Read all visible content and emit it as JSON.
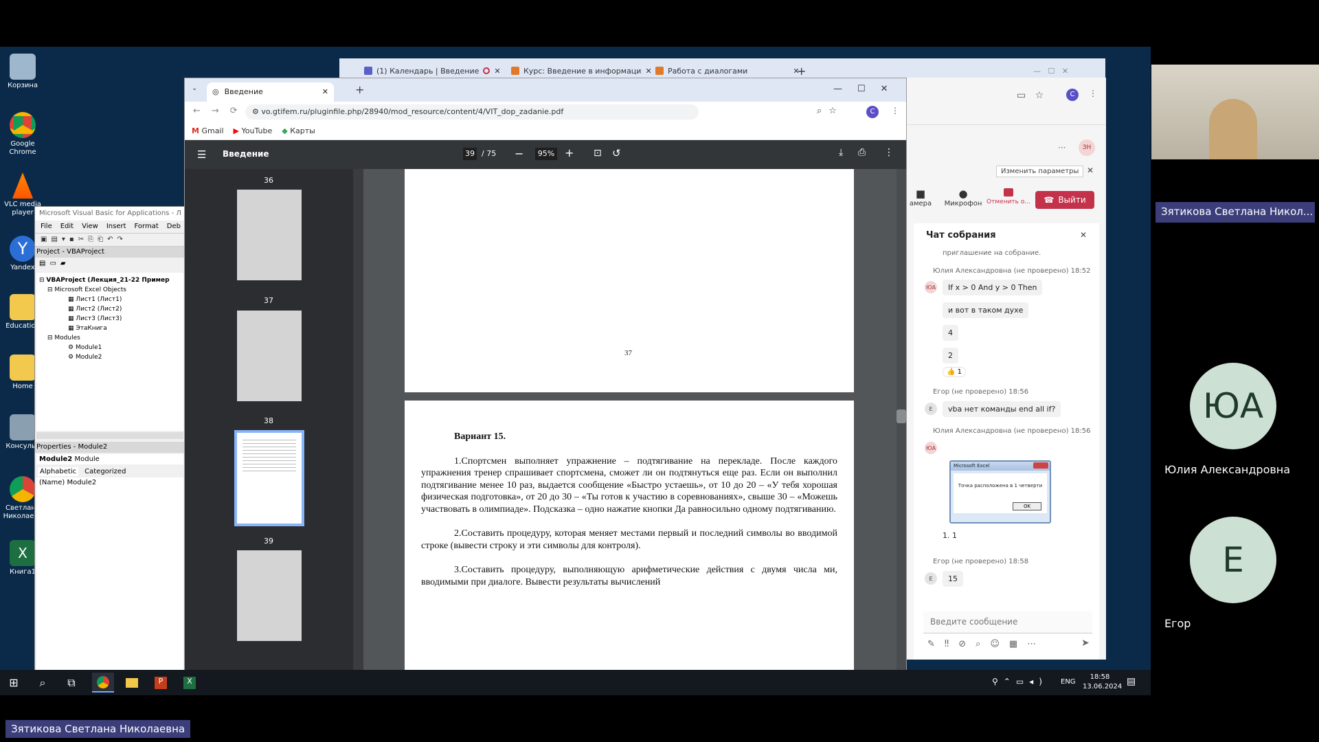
{
  "desktop": {
    "icons": [
      "Корзина",
      "Google Chrome",
      "VLC media player",
      "Yandex",
      "Education",
      "Home",
      "Консульт",
      "Светлана Николаева",
      "Книга1"
    ]
  },
  "taskbar": {
    "lang": "ENG",
    "time": "18:58",
    "date": "13.06.2024"
  },
  "back_browser": {
    "tabs": [
      "(1) Календарь | Введение",
      "Курс: Введение в информаци",
      "Работа с диалогами"
    ]
  },
  "vba": {
    "title": "Microsoft Visual Basic for Applications - Л",
    "menu": [
      "File",
      "Edit",
      "View",
      "Insert",
      "Format",
      "Deb"
    ],
    "project_title": "Project - VBAProject",
    "tree": [
      "VBAProject (Лекция_21-22 Пример",
      "Microsoft Excel Objects",
      "Лист1 (Лист1)",
      "Лист2 (Лист2)",
      "Лист3 (Лист3)",
      "ЭтаКнига",
      "Modules",
      "Module1",
      "Module2"
    ],
    "properties_title": "Properties - Module2",
    "prop_object": "Module2",
    "prop_type": "Module",
    "prop_tabs": [
      "Alphabetic",
      "Categorized"
    ],
    "prop_name_key": "(Name)",
    "prop_name_val": "Module2"
  },
  "browser": {
    "tab_title": "Введение",
    "url": "vo.gtifem.ru/pluginfile.php/28940/mod_resource/content/4/VIT_dop_zadanie.pdf",
    "profile": "С",
    "bookmarks": [
      "Gmail",
      "YouTube",
      "Карты"
    ]
  },
  "pdf": {
    "doc_title": "Введение",
    "page_current": "39",
    "page_total": "/ 75",
    "zoom": "95%",
    "thumb_labels": [
      "36",
      "37",
      "38",
      "39"
    ],
    "page37_number": "37",
    "heading": "Вариант 15.",
    "p1": "1.Спортсмен выполняет упражнение – подтягивание на перекладе. После каждого упражнения тренер спрашивает спортсмена, сможет ли он подтянуться еще раз. Если он выполнил подтягивание менее 10 раз, выдается сообщение «Быстро устаешь», от 10 до 20 – «У тебя хорошая физическая подготовка», от 20 до 30 – «Ты готов к участию в соревнованиях», свыше 30 – «Можешь участвовать в олимпиаде». Подсказка – одно нажатие кнопки Да равносильно одному подтягиванию.",
    "p2": "2.Составить процедуру, которая меняет местами первый и последний символы во вводимой строке (вывести строку и эти символы для контроля).",
    "p3": "3.Составить процедуру, выполняющую арифметические действия с двумя числа ми, вводимыми при диалоге. Вывести результаты вычислений"
  },
  "teams": {
    "avatar": "ЗН",
    "change_params": "Изменить параметры",
    "camera": "амера",
    "mic": "Микрофон",
    "cancel": "Отменить о...",
    "leave": "Выйти",
    "chat_title": "Чат собрания",
    "cut_text": "приглашение на собрание.",
    "messages": [
      {
        "meta": "Юлия Александровна (не проверено)  18:52",
        "initials": "ЮА",
        "lines": [
          "If x > 0 And y > 0 Then",
          "и вот в таком духе",
          "4",
          "2"
        ],
        "reaction": "👍 1"
      },
      {
        "meta": "Егор (не проверено)  18:56",
        "initials": "Е",
        "lines": [
          "vba нет команды end all if?"
        ]
      },
      {
        "meta": "Юлия Александровна (не проверено)  18:56",
        "initials": "ЮА",
        "dialog_title": "Microsoft Excel",
        "dialog_text": "Точка расположена в 1 четверти",
        "dialog_ok": "OK",
        "after": "1. 1"
      },
      {
        "meta": "Егор (не проверено)  18:58",
        "initials": "Е",
        "lines": [
          "15"
        ]
      }
    ],
    "input_placeholder": "Введите сообщение"
  },
  "participants": {
    "speaker_name": "Зятикова Светлана Никол...",
    "p1_initials": "ЮА",
    "p1_name": "Юлия Александровна",
    "p2_initials": "Е",
    "p2_name": "Егор"
  },
  "presenter_label": "Зятикова Светлана Николаевна",
  "colors": {
    "leave_red": "#c4314b",
    "pdf_toolbar": "#323639",
    "avatar_green": "#cde0d4",
    "name_badge": "#3b3e7a"
  }
}
